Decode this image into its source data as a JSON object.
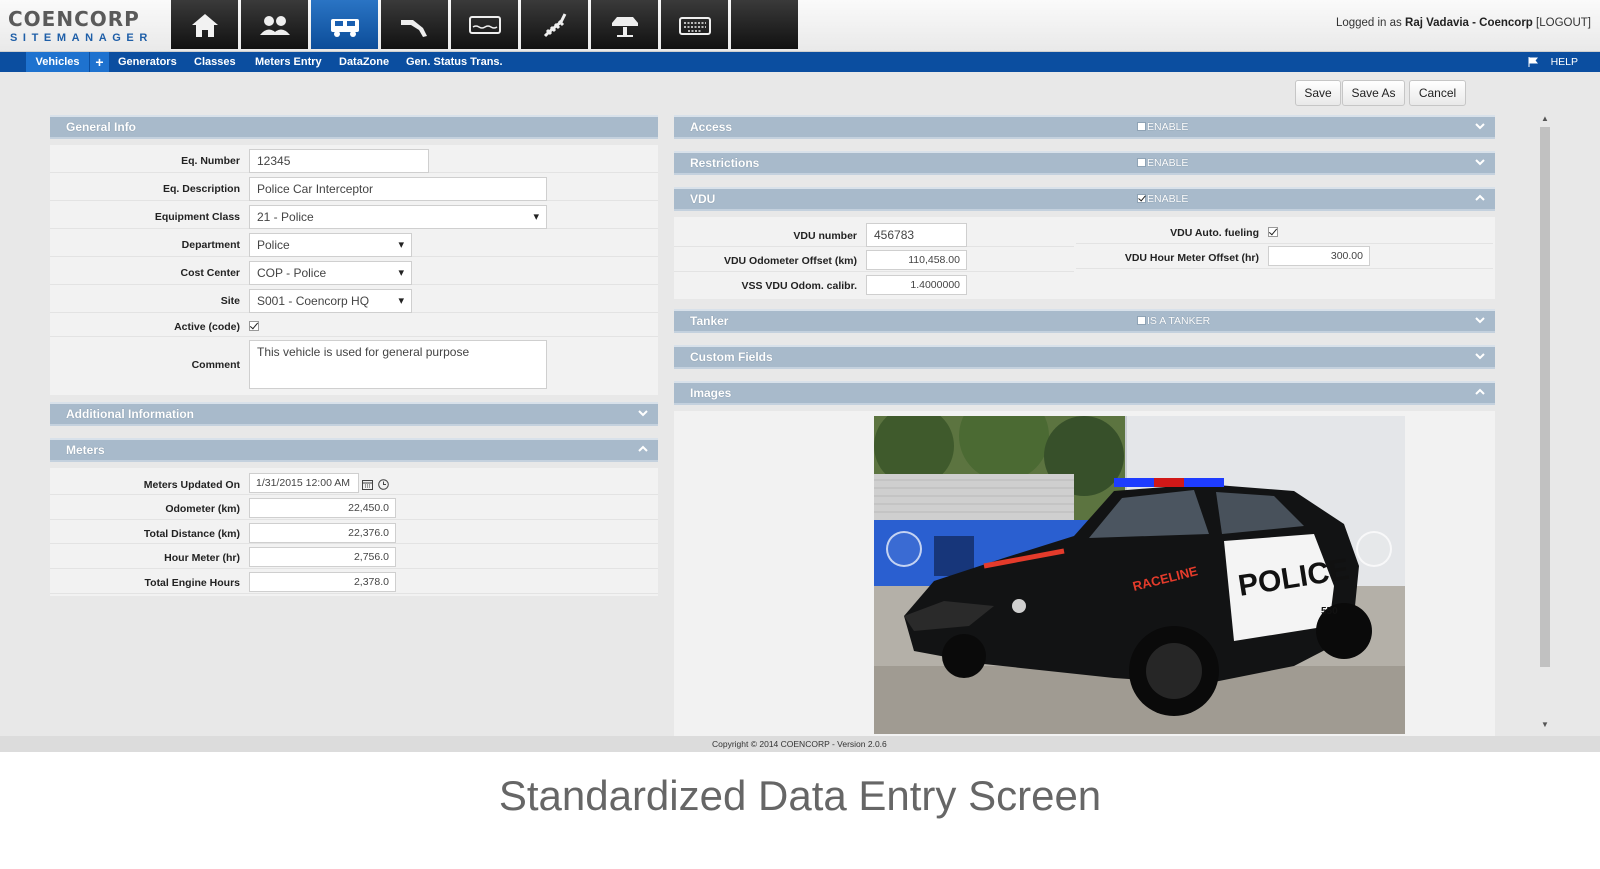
{
  "app": {
    "logo_main": "COENCORP",
    "logo_sub": "SITEMANAGER",
    "modules": [
      {
        "icon": "home-icon"
      },
      {
        "icon": "users-icon"
      },
      {
        "icon": "vehicle-truck-icon",
        "active": true
      },
      {
        "icon": "fuel-nozzle-icon"
      },
      {
        "icon": "tank-gauge-icon"
      },
      {
        "icon": "spring-icon"
      },
      {
        "icon": "car-lift-icon"
      },
      {
        "icon": "keyboard-icon"
      },
      {
        "icon": "blank"
      }
    ],
    "login": {
      "prefix": "Logged in as",
      "user": "Raj Vadavia - Coencorp",
      "logout": "[LOGOUT]"
    }
  },
  "nav": {
    "items": [
      "Vehicles",
      "Generators",
      "Classes",
      "Meters Entry",
      "DataZone",
      "Gen. Status Trans."
    ],
    "plus": "+",
    "help": "HELP"
  },
  "toolbar": {
    "save": "Save",
    "save_as": "Save As",
    "cancel": "Cancel"
  },
  "general": {
    "title": "General Info",
    "eq_number_label": "Eq. Number",
    "eq_number": "12345",
    "eq_desc_label": "Eq. Description",
    "eq_desc": "Police Car Interceptor",
    "class_label": "Equipment Class",
    "class": "21 - Police",
    "dept_label": "Department",
    "dept": "Police",
    "cost_label": "Cost Center",
    "cost": "COP - Police",
    "site_label": "Site",
    "site": "S001 - Coencorp HQ",
    "active_label": "Active (code)",
    "comment_label": "Comment",
    "comment": "This vehicle is used for general purpose"
  },
  "additional": {
    "title": "Additional Information"
  },
  "meters": {
    "title": "Meters",
    "updated_label": "Meters Updated On",
    "updated": "1/31/2015 12:00 AM",
    "odo_label": "Odometer (km)",
    "odo": "22,450.0",
    "dist_label": "Total Distance (km)",
    "dist": "22,376.0",
    "hour_label": "Hour Meter (hr)",
    "hour": "2,756.0",
    "eng_label": "Total Engine Hours",
    "eng": "2,378.0"
  },
  "access": {
    "title": "Access",
    "enable": "ENABLE"
  },
  "restrictions": {
    "title": "Restrictions",
    "enable": "ENABLE"
  },
  "vdu": {
    "title": "VDU",
    "enable": "ENABLE",
    "number_label": "VDU number",
    "number": "456783",
    "odo_off_label": "VDU Odometer Offset (km)",
    "odo_off": "110,458.00",
    "vss_label": "VSS VDU Odom. calibr.",
    "vss": "1.4000000",
    "auto_label": "VDU Auto. fueling",
    "hour_off_label": "VDU Hour Meter Offset (hr)",
    "hour_off": "300.00"
  },
  "tanker": {
    "title": "Tanker",
    "flag": "IS A TANKER"
  },
  "custom": {
    "title": "Custom Fields"
  },
  "images": {
    "title": "Images",
    "car_text": "POLICE",
    "car_stripe": "RACELINE",
    "car_number": "550"
  },
  "footer": {
    "copyright": "Copyright © 2014 COENCORP - Version 2.0.6"
  },
  "caption": "Standardized Data Entry Screen"
}
